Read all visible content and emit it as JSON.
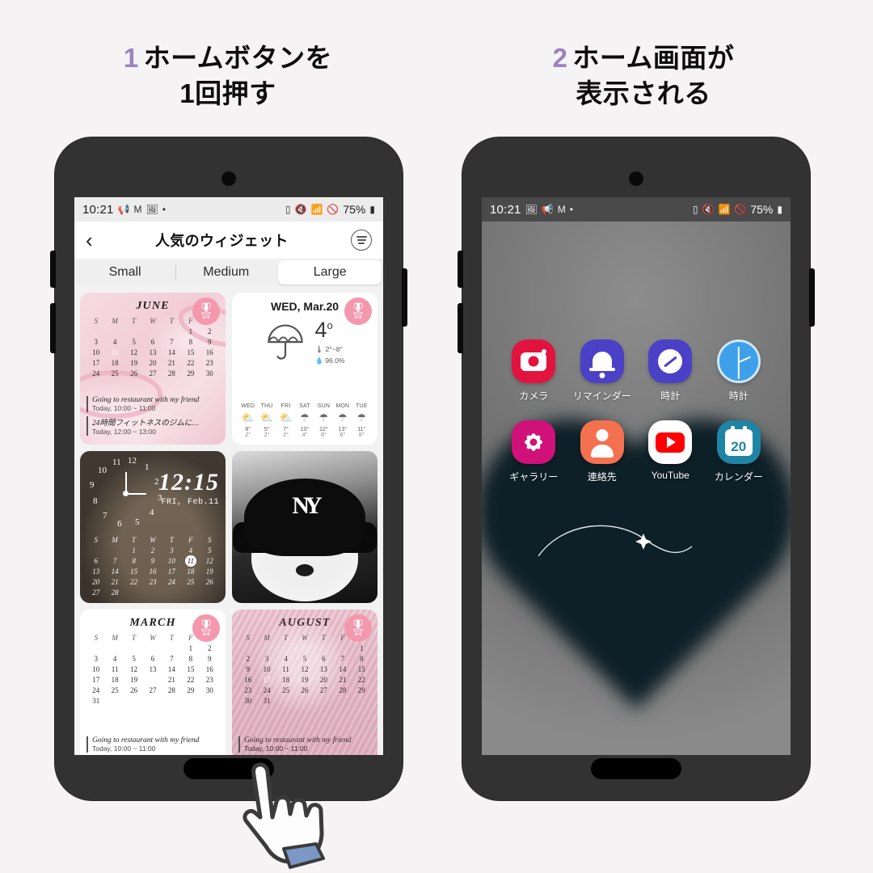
{
  "steps": [
    {
      "num": "1",
      "line1": "ホームボタンを",
      "line2": "1回押す"
    },
    {
      "num": "2",
      "line1": "ホーム画面が",
      "line2": "表示される"
    }
  ],
  "colors": {
    "accent_purple": "#9b83bf",
    "background": "#f5f3f4",
    "phone_frame": "#323232",
    "badge_pink": "#f498ae"
  },
  "phone_left": {
    "statusbar": {
      "time": "10:21",
      "icons": [
        "megaphone-icon",
        "gmail-icon",
        "photos-icon",
        "dot-icon"
      ],
      "right_icons": [
        "sim-icon",
        "mute-icon",
        "wifi-icon",
        "dnd-icon"
      ],
      "battery": "75%"
    },
    "header": {
      "back": "‹",
      "title": "人気のウィジェット",
      "menu": "menu-icon"
    },
    "tabs": [
      {
        "label": "Small",
        "active": false
      },
      {
        "label": "Medium",
        "active": false
      },
      {
        "label": "Large",
        "active": true
      }
    ],
    "widgets": [
      {
        "type": "calendar",
        "month": "JUNE",
        "dows": [
          "S",
          "M",
          "T",
          "W",
          "T",
          "F",
          "S"
        ],
        "lead_blanks": 5,
        "days": 30,
        "selected": 11,
        "events": [
          {
            "title": "Going to restaurant with my friend",
            "time": "Today, 10:00 ~ 11:00"
          },
          {
            "title": "24時間フィットネスのジムに…",
            "time": "Today, 12:00 ~ 13:00"
          }
        ],
        "badge": "ribbon-badge-icon"
      },
      {
        "type": "weather",
        "date": "WED, Mar.20",
        "icon": "umbrella-icon",
        "temp": "4",
        "deg": "o",
        "range": "2°~8°",
        "humidity": "96.0%",
        "range_icon": "thermometer-icon",
        "hum_icon": "droplet-icon",
        "forecast": [
          {
            "day": "WED",
            "icon": "sun-cloud-icon",
            "hi": "8°",
            "lo": "2°"
          },
          {
            "day": "THU",
            "icon": "sun-cloud-icon",
            "hi": "5°",
            "lo": "2°"
          },
          {
            "day": "FRI",
            "icon": "sun-cloud-icon",
            "hi": "7°",
            "lo": "2°"
          },
          {
            "day": "SAT",
            "icon": "umbrella-icon",
            "hi": "10°",
            "lo": "4°"
          },
          {
            "day": "SUN",
            "icon": "umbrella-icon",
            "hi": "12°",
            "lo": "8°"
          },
          {
            "day": "MON",
            "icon": "umbrella-icon",
            "hi": "13°",
            "lo": "6°"
          },
          {
            "day": "TUE",
            "icon": "umbrella-icon",
            "hi": "11°",
            "lo": "8°"
          }
        ],
        "badge": "ribbon-badge-icon"
      },
      {
        "type": "clock-photo",
        "photo": "cat-photo",
        "digital_time": "12:15",
        "date": "FRI, Feb.11",
        "clock_numerals": [
          "1",
          "2",
          "3",
          "4",
          "5",
          "6",
          "7",
          "8",
          "9",
          "10",
          "11",
          "12"
        ],
        "dows": [
          "S",
          "M",
          "T",
          "W",
          "T",
          "F",
          "S"
        ],
        "lead_blanks": 2,
        "days": 28,
        "selected": 11
      },
      {
        "type": "photo",
        "photo": "dog-with-ny-beanie-photo",
        "logo": "NY"
      },
      {
        "type": "calendar",
        "month": "MARCH",
        "dows": [
          "S",
          "M",
          "T",
          "W",
          "T",
          "F",
          "S"
        ],
        "lead_blanks": 5,
        "days": 31,
        "selected": 20,
        "events": [
          {
            "title": "Going to restaurant with my friend",
            "time": "Today, 10:00 ~ 11:00"
          }
        ],
        "badge": "ribbon-badge-icon"
      },
      {
        "type": "calendar",
        "month": "AUGUST",
        "dows": [
          "S",
          "M",
          "T",
          "W",
          "T",
          "F",
          "S"
        ],
        "lead_blanks": 6,
        "days": 31,
        "selected": 17,
        "events": [
          {
            "title": "Going to restaurant with my friend",
            "time": "Today, 10:00 ~ 11:00"
          }
        ],
        "badge": "ribbon-badge-icon"
      }
    ]
  },
  "phone_right": {
    "statusbar": {
      "time": "10:21",
      "icons": [
        "photos-icon",
        "megaphone-icon",
        "gmail-icon",
        "dot-icon"
      ],
      "right_icons": [
        "sim-icon",
        "mute-icon",
        "wifi-icon",
        "dnd-icon"
      ],
      "battery": "75%"
    },
    "wallpaper": "blurred-dark-heart-with-sparkle",
    "apps": [
      {
        "label": "カメラ",
        "icon": "camera-icon",
        "color": "#e3133f"
      },
      {
        "label": "リマインダー",
        "icon": "bell-icon",
        "color": "#4a41c7"
      },
      {
        "label": "時計",
        "icon": "compass-icon",
        "color": "#4a41c7"
      },
      {
        "label": "時計",
        "icon": "clock-icon",
        "color": "#3ea0e8"
      },
      {
        "label": "ギャラリー",
        "icon": "flower-gallery-icon",
        "color": "#cf1179"
      },
      {
        "label": "連絡先",
        "icon": "person-contacts-icon",
        "color": "#f4714f"
      },
      {
        "label": "YouTube",
        "icon": "youtube-icon",
        "color": "#ffffff"
      },
      {
        "label": "カレンダー",
        "icon": "calendar-20-icon",
        "color": "#1f85a5"
      }
    ]
  },
  "cursor": {
    "icon": "pointing-hand-cursor"
  }
}
